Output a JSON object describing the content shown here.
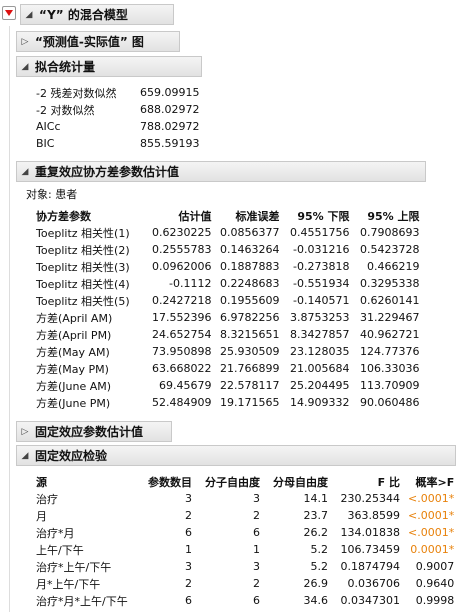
{
  "report": {
    "title": "“Y” 的混合模型",
    "pred_actual": {
      "label": "“预测值-实际值” 图"
    },
    "fit_stats": {
      "label": "拟合统计量",
      "rows": [
        {
          "name": "-2 残差对数似然",
          "value": "659.09915"
        },
        {
          "name": "-2 对数似然",
          "value": "688.02972"
        },
        {
          "name": "AICc",
          "value": "788.02972"
        },
        {
          "name": "BIC",
          "value": "855.59193"
        }
      ]
    },
    "cov_params": {
      "label": "重复效应协方差参数估计值",
      "subject": "对象: 患者",
      "headers": [
        "协方差参数",
        "估计值",
        "标准误差",
        "95% 下限",
        "95% 上限"
      ],
      "rows": [
        [
          "Toeplitz 相关性(1)",
          "0.6230225",
          "0.0856377",
          "0.4551756",
          "0.7908693"
        ],
        [
          "Toeplitz 相关性(2)",
          "0.2555783",
          "0.1463264",
          "-0.031216",
          "0.5423728"
        ],
        [
          "Toeplitz 相关性(3)",
          "0.0962006",
          "0.1887883",
          "-0.273818",
          "0.466219"
        ],
        [
          "Toeplitz 相关性(4)",
          "-0.1112",
          "0.2248683",
          "-0.551934",
          "0.3295338"
        ],
        [
          "Toeplitz 相关性(5)",
          "0.2427218",
          "0.1955609",
          "-0.140571",
          "0.6260141"
        ],
        [
          "方差(April AM)",
          "17.552396",
          "6.9782256",
          "3.8753253",
          "31.229467"
        ],
        [
          "方差(April PM)",
          "24.652754",
          "8.3215651",
          "8.3427857",
          "40.962721"
        ],
        [
          "方差(May AM)",
          "73.950898",
          "25.930509",
          "23.128035",
          "124.77376"
        ],
        [
          "方差(May PM)",
          "63.668022",
          "21.766899",
          "21.005684",
          "106.33036"
        ],
        [
          "方差(June AM)",
          "69.45679",
          "22.578117",
          "25.204495",
          "113.70909"
        ],
        [
          "方差(June PM)",
          "52.484909",
          "19.171565",
          "14.909332",
          "90.060486"
        ]
      ]
    },
    "fixed_params": {
      "label": "固定效应参数估计值"
    },
    "fixed_tests": {
      "label": "固定效应检验",
      "headers": [
        "源",
        "参数数目",
        "分子自由度",
        "分母自由度",
        "F 比",
        "概率>F"
      ],
      "rows": [
        [
          "治疗",
          "3",
          "3",
          "14.1",
          "230.25344",
          "<.0001*"
        ],
        [
          "月",
          "2",
          "2",
          "23.7",
          "363.8599",
          "<.0001*"
        ],
        [
          "治疗*月",
          "6",
          "6",
          "26.2",
          "134.01838",
          "<.0001*"
        ],
        [
          "上午/下午",
          "1",
          "1",
          "5.2",
          "106.73459",
          "0.0001*"
        ],
        [
          "治疗*上午/下午",
          "3",
          "3",
          "5.2",
          "0.1874794",
          "0.9007"
        ],
        [
          "月*上午/下午",
          "2",
          "2",
          "26.9",
          "0.036706",
          "0.9640"
        ],
        [
          "治疗*月*上午/下午",
          "6",
          "6",
          "34.6",
          "0.0347301",
          "0.9998"
        ]
      ],
      "significant_color": "#e8820c"
    }
  }
}
